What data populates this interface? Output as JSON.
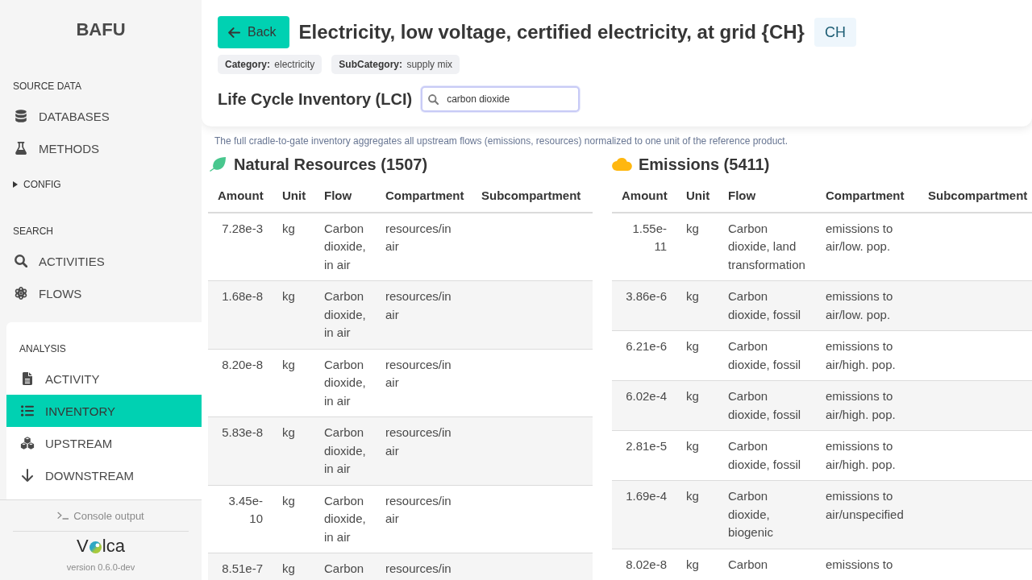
{
  "sidebar": {
    "title": "BAFU",
    "source_data": {
      "heading": "SOURCE DATA",
      "items": [
        {
          "label": "DATABASES",
          "selected": false
        },
        {
          "label": "METHODS",
          "selected": false
        }
      ]
    },
    "config": {
      "label": "CONFIG",
      "expanded": false
    },
    "search": {
      "heading": "SEARCH",
      "items": [
        {
          "label": "ACTIVITIES",
          "selected": false
        },
        {
          "label": "FLOWS",
          "selected": false
        }
      ]
    },
    "analysis": {
      "heading": "ANALYSIS",
      "items": [
        {
          "label": "ACTIVITY",
          "selected": false
        },
        {
          "label": "INVENTORY",
          "selected": true
        },
        {
          "label": "UPSTREAM",
          "selected": false
        },
        {
          "label": "DOWNSTREAM",
          "selected": false
        }
      ]
    },
    "console_button": "Console output",
    "logo": {
      "lead": "V",
      "tail": "lca"
    },
    "version": "version 0.6.0-dev"
  },
  "header": {
    "back_button": "Back",
    "title": "Electricity, low voltage, certified electricity, at grid {CH}",
    "location_badge": "CH",
    "tags": [
      "**Category:** electricity",
      "**SubCategory:** supply mix"
    ],
    "section_title": "Life Cycle Inventory (LCI)",
    "search": {
      "value": "carbon dioxide",
      "focused": true
    }
  },
  "description": "The full cradle-to-gate inventory aggregates all upstream flows (emissions, resources) normalized to one unit of the reference product.",
  "tables": [
    {
      "kind": "resources",
      "title": "Natural Resources (1507)",
      "columns": [
        "Amount",
        "Unit",
        "Flow",
        "Compartment",
        "Subcompartment"
      ],
      "rows": [
        {
          "amount": "7.28e-3",
          "unit": "kg",
          "flow": "Carbon dioxide, in air",
          "compartment": "resources/in air"
        },
        {
          "amount": "1.68e-8",
          "unit": "kg",
          "flow": "Carbon dioxide, in air",
          "compartment": "resources/in air"
        },
        {
          "amount": "8.20e-8",
          "unit": "kg",
          "flow": "Carbon dioxide, in air",
          "compartment": "resources/in air"
        },
        {
          "amount": "5.83e-8",
          "unit": "kg",
          "flow": "Carbon dioxide, in air",
          "compartment": "resources/in air"
        },
        {
          "amount": "3.45e-10",
          "unit": "kg",
          "flow": "Carbon dioxide, in air",
          "compartment": "resources/in air"
        },
        {
          "amount": "8.51e-7",
          "unit": "kg",
          "flow": "Carbon",
          "compartment": "resources/in"
        }
      ]
    },
    {
      "kind": "emissions",
      "title": "Emissions (5411)",
      "columns": [
        "Amount",
        "Unit",
        "Flow",
        "Compartment",
        "Subcompartment"
      ],
      "rows": [
        {
          "amount": "1.55e-11",
          "unit": "kg",
          "flow": "Carbon dioxide, land transformation",
          "compartment": "emissions to air/low. pop."
        },
        {
          "amount": "3.86e-6",
          "unit": "kg",
          "flow": "Carbon dioxide, fossil",
          "compartment": "emissions to air/low. pop."
        },
        {
          "amount": "6.21e-6",
          "unit": "kg",
          "flow": "Carbon dioxide, fossil",
          "compartment": "emissions to air/high. pop."
        },
        {
          "amount": "6.02e-4",
          "unit": "kg",
          "flow": "Carbon dioxide, fossil",
          "compartment": "emissions to air/high. pop."
        },
        {
          "amount": "2.81e-5",
          "unit": "kg",
          "flow": "Carbon dioxide, fossil",
          "compartment": "emissions to air/high. pop."
        },
        {
          "amount": "1.69e-4",
          "unit": "kg",
          "flow": "Carbon dioxide, biogenic",
          "compartment": "emissions to air/unspecified"
        },
        {
          "amount": "8.02e-8",
          "unit": "kg",
          "flow": "Carbon",
          "compartment": "emissions to"
        }
      ]
    }
  ]
}
